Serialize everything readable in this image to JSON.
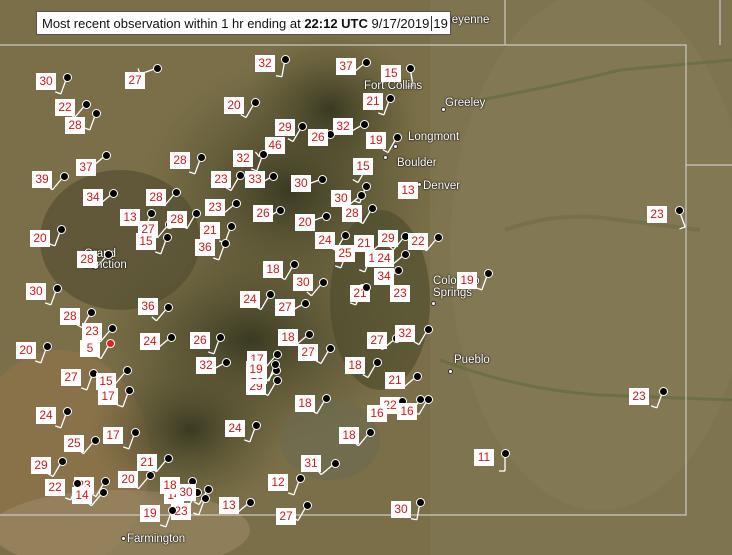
{
  "header": {
    "prefix": "Most recent observation within 1 hr ending at ",
    "time": "22:12 UTC",
    "date": "9/17/2019",
    "trunc": "19"
  },
  "cities": [
    {
      "name": "Cheyenne"
    },
    {
      "name": "Fort Collins"
    },
    {
      "name": "Greeley"
    },
    {
      "name": "Longmont"
    },
    {
      "name": "Boulder"
    },
    {
      "name": "Denver"
    },
    {
      "name": "Grand Junction"
    },
    {
      "name": "Colorado Springs"
    },
    {
      "name": "Pueblo"
    },
    {
      "name": "Farmington"
    }
  ],
  "stations": [
    "30",
    "27",
    "32",
    "37",
    "15",
    "22",
    "28",
    "20",
    "21",
    "32",
    "29",
    "46",
    "26",
    "15",
    "19",
    "39",
    "37",
    "28",
    "32",
    "33",
    "23",
    "30",
    "13",
    "34",
    "28",
    "13",
    "27",
    "15",
    "28",
    "23",
    "26",
    "21",
    "20",
    "28",
    "30",
    "24",
    "21",
    "29",
    "22",
    "36",
    "12",
    "24",
    "25",
    "18",
    "30",
    "21",
    "34",
    "28",
    "20",
    "23",
    "19",
    "30",
    "28",
    "27",
    "36",
    "24",
    "27",
    "32",
    "23",
    "26",
    "18",
    "27",
    "20",
    "5",
    "24",
    "17",
    "27",
    "18",
    "15",
    "17",
    "32",
    "29",
    "18",
    "19",
    "21",
    "24",
    "18",
    "22",
    "25",
    "16",
    "16",
    "24",
    "18",
    "29",
    "21",
    "17",
    "31",
    "23",
    "20",
    "12",
    "14",
    "18",
    "23",
    "14",
    "30",
    "22",
    "13",
    "27",
    "19",
    "11",
    "23",
    "30",
    "23"
  ],
  "colors": {
    "value_text": "#d01818",
    "station": "#000000",
    "station_highlight": "#e02020"
  }
}
